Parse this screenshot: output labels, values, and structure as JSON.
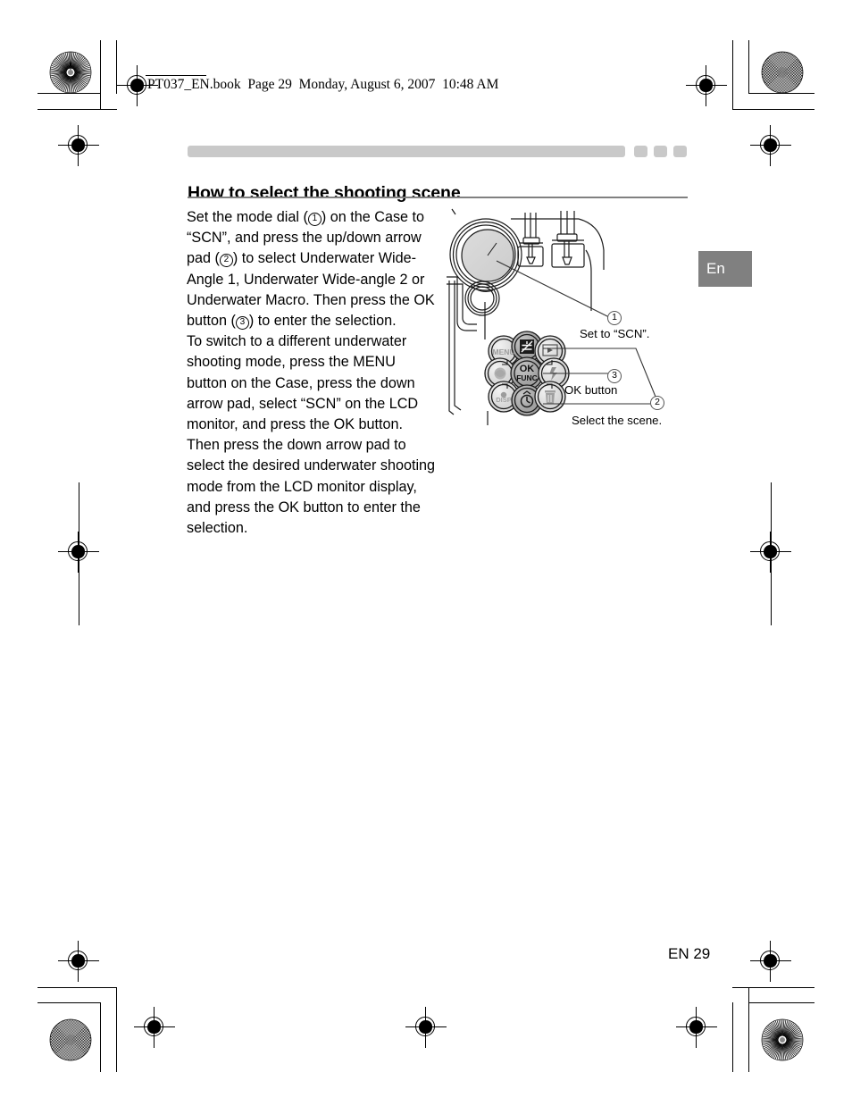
{
  "document": {
    "header_line": "PT037_EN.book  Page 29  Monday, August 6, 2007  10:48 AM",
    "title": "How to select the shooting scene",
    "lang_tab": "En",
    "footer_page": "EN 29"
  },
  "body": {
    "paragraph1_parts": {
      "a": "Set the mode dial (",
      "n1": "1",
      "b": ") on the Case to “SCN”, and press the up/down arrow pad (",
      "n2": "2",
      "c": ") to select Underwater Wide-Angle 1, Underwater Wide-angle 2 or Underwater Macro. Then press the OK button (",
      "n3": "3",
      "d": ") to enter the selection."
    },
    "paragraph2": "To switch to a different underwater shooting mode, press the MENU button on the Case, press the down arrow pad, select “SCN” on the LCD monitor, and press the OK button. Then press the down arrow pad to select the desired underwater shooting mode from the LCD monitor display, and press the OK button to enter the selection."
  },
  "figure": {
    "alt": "Camera case top controls: mode dial, shutter buttons and arrow pad cluster",
    "callouts": [
      {
        "number": "1",
        "label": "Set to “SCN”."
      },
      {
        "number": "3",
        "label": "OK button"
      },
      {
        "number": "2",
        "label": "Select the scene."
      }
    ],
    "button_labels": {
      "menu": "MENU",
      "playback": "▶",
      "exposure": "±",
      "macro": "macro-flower",
      "ok": "OK",
      "ok_sub": "FUNC",
      "flash": "flash-bolt",
      "disp": "DISP",
      "timer": "self-timer",
      "erase": "erase-trash"
    }
  },
  "colors": {
    "deco_gray": "#c9c9c9",
    "rule_gray": "#808080",
    "tab_gray": "#808080",
    "dial_fill": "#d0d0d0",
    "button_light": "#e3e3e3",
    "button_dark": "#b0b0b0"
  }
}
